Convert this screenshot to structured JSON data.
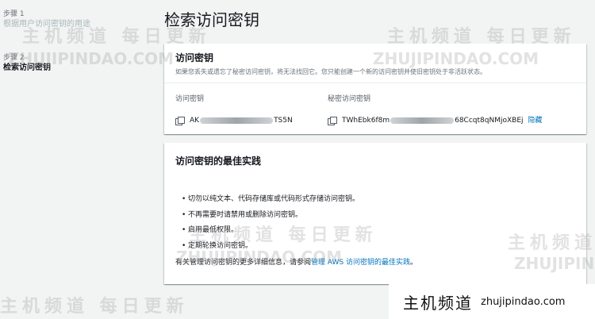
{
  "sidebar": {
    "steps": [
      {
        "num": "步骤 1",
        "title": "根据用户访问密钥的用途"
      },
      {
        "num": "步骤 2",
        "title": "检索访问密钥"
      }
    ]
  },
  "page": {
    "title": "检索访问密钥"
  },
  "access_key_card": {
    "title": "访问密钥",
    "description": "如果您丢失或遗忘了秘密访问密钥，将无法找回它。您只能创建一个新的访问密钥并使旧密钥处于非活跃状态。",
    "access_key_label": "访问密钥",
    "access_key_prefix": "AK",
    "access_key_suffix": "TS5N",
    "secret_key_label": "秘密访问密钥",
    "secret_key_prefix": "TWhEbk6f8m",
    "secret_key_suffix": "68Ccqt8qNMjoXBEj",
    "hide_label": "隐藏"
  },
  "best_practices_card": {
    "title": "访问密钥的最佳实践",
    "items": [
      "切勿以纯文本、代码存储库或代码形式存储访问密钥。",
      "不再需要时请禁用或删除访问密钥。",
      "启用最低权限。",
      "定期轮换访问密钥。"
    ],
    "note_prefix": "有关管理访问密钥的更多详细信息，请参阅",
    "note_link": "管理 AWS 访问密钥的最佳实践",
    "note_suffix": "。"
  },
  "watermark": {
    "cn": "主机频道 每日更新",
    "en": "ZHUJIPINDAO.COM",
    "banner_cn": "主机频道",
    "banner_url": "zhujipindao.com"
  },
  "colors": {
    "link": "#0073bb",
    "background": "#f2f3f3",
    "card": "#ffffff"
  }
}
